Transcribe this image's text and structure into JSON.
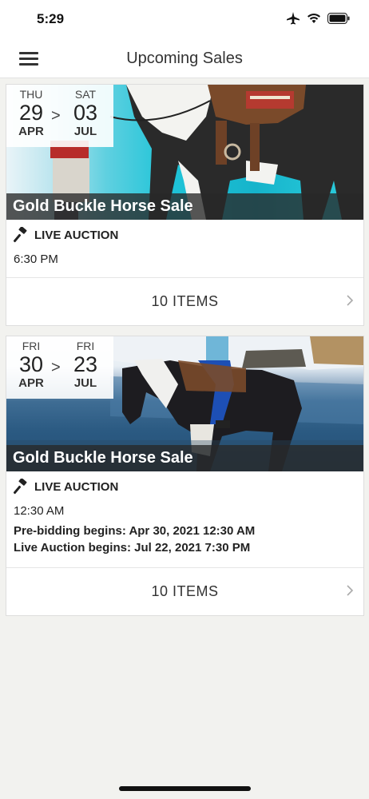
{
  "status": {
    "time": "5:29"
  },
  "header": {
    "title": "Upcoming Sales"
  },
  "sales": [
    {
      "start": {
        "dow": "THU",
        "day": "29",
        "month": "APR"
      },
      "end": {
        "dow": "SAT",
        "day": "03",
        "month": "JUL"
      },
      "separator": ">",
      "title": "Gold Buckle Horse Sale",
      "type": "LIVE AUCTION",
      "time": "6:30 PM",
      "items": "10 ITEMS"
    },
    {
      "start": {
        "dow": "FRI",
        "day": "30",
        "month": "APR"
      },
      "end": {
        "dow": "FRI",
        "day": "23",
        "month": "JUL"
      },
      "separator": ">",
      "title": "Gold Buckle Horse Sale",
      "type": "LIVE AUCTION",
      "time": "12:30 AM",
      "prebid": "Pre-bidding begins: Apr 30, 2021 12:30 AM",
      "live": "Live Auction begins: Jul 22, 2021 7:30 PM",
      "items": "10 ITEMS"
    }
  ],
  "icons": {
    "menu": "hamburger-menu-icon",
    "auction": "gavel-icon",
    "chevron": "chevron-right-icon",
    "airplane": "airplane-icon",
    "wifi": "wifi-icon",
    "battery": "battery-icon"
  }
}
